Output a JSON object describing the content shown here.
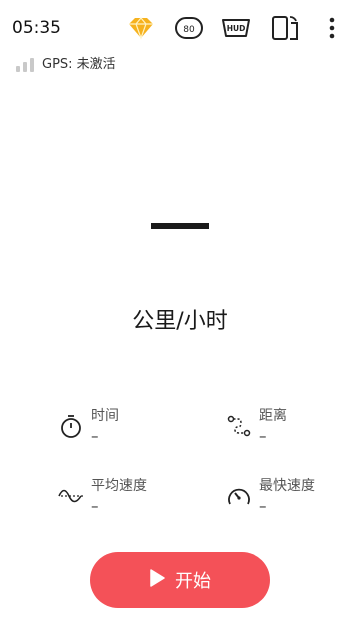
{
  "status": {
    "time": "05:35"
  },
  "gps": {
    "label": "GPS: 未激活"
  },
  "speed": {
    "value": "—",
    "unit": "公里/小时"
  },
  "toolbar": {
    "icons": [
      "premium-diamond-icon",
      "80-badge-icon",
      "hud-icon",
      "screen-rotate-icon",
      "more-vert-icon"
    ]
  },
  "stats": {
    "time": {
      "label": "时间",
      "value": "–"
    },
    "distance": {
      "label": "距离",
      "value": "–"
    },
    "avg_speed": {
      "label": "平均速度",
      "value": "–"
    },
    "max_speed": {
      "label": "最快速度",
      "value": "–"
    }
  },
  "start_button": {
    "label": "开始"
  },
  "colors": {
    "accent": "#f45158",
    "diamond": "#f6b21e"
  }
}
